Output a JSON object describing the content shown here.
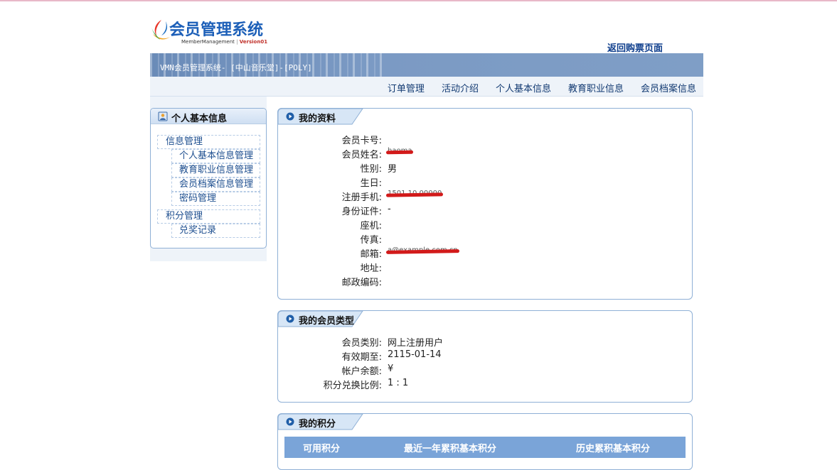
{
  "header": {
    "logo_title": "会员管理系统",
    "logo_sub": "MemberManagement",
    "logo_version": "Version01",
    "back_link": "返回购票页面",
    "banner_text": "VMN会员管理系统- [中山音乐堂]-[POLY]"
  },
  "nav": {
    "items": [
      "订单管理",
      "活动介绍",
      "个人基本信息",
      "教育职业信息",
      "会员档案信息"
    ]
  },
  "sidebar": {
    "title": "个人基本信息",
    "groups": [
      {
        "label": "信息管理",
        "items": [
          "个人基本信息管理",
          "教育职业信息管理",
          "会员档案信息管理",
          "密码管理"
        ]
      },
      {
        "label": "积分管理",
        "items": [
          "兑奖记录"
        ]
      }
    ]
  },
  "profile": {
    "title": "我的资料",
    "fields": [
      {
        "label": "会员卡号:",
        "value": ""
      },
      {
        "label": "会员姓名:",
        "value": "haoma"
      },
      {
        "label": "性别:",
        "value": "男"
      },
      {
        "label": "生日:",
        "value": ""
      },
      {
        "label": "注册手机:",
        "value": "1501 10 00000"
      },
      {
        "label": "身份证件:",
        "value": "-"
      },
      {
        "label": "座机:",
        "value": ""
      },
      {
        "label": "传真:",
        "value": ""
      },
      {
        "label": "邮箱:",
        "value": "a@example.com.cn"
      },
      {
        "label": "地址:",
        "value": ""
      },
      {
        "label": "邮政编码:",
        "value": ""
      }
    ]
  },
  "membership": {
    "title": "我的会员类型",
    "fields": [
      {
        "label": "会员类别:",
        "value": "网上注册用户"
      },
      {
        "label": "有效期至:",
        "value": "2115-01-14"
      },
      {
        "label": "帐户余额:",
        "value": "¥"
      },
      {
        "label": "积分兑换比例:",
        "value": "1 : 1"
      }
    ]
  },
  "points": {
    "title": "我的积分",
    "headers": [
      "可用积分",
      "最近一年累积基本积分",
      "历史累积基本积分"
    ]
  },
  "colors": {
    "banner": "#7b9ac4",
    "nav_bg": "#eef3f9",
    "panel_border": "#8fb0d6",
    "table_header": "#7aa4d8",
    "link": "#0d3d8c"
  }
}
